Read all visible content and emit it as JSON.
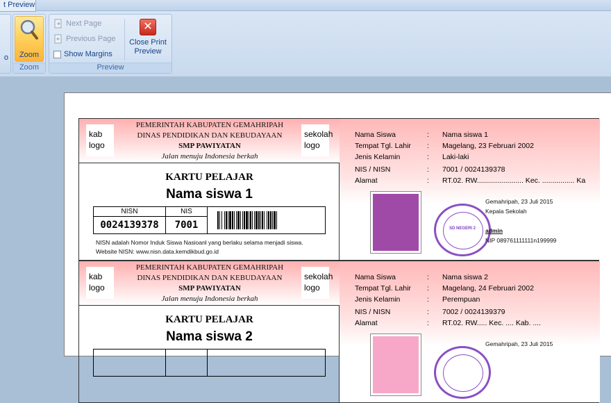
{
  "ribbon": {
    "tab_label": "t Preview",
    "zoom_group": {
      "label": "Zoom",
      "button_label": "Zoom"
    },
    "preview_group": {
      "label": "Preview",
      "next_page": "Next Page",
      "previous_page": "Previous Page",
      "show_margins": "Show Margins",
      "close_line1": "Close Print",
      "close_line2": "Preview"
    }
  },
  "cards": [
    {
      "header": {
        "line1": "PEMERINTAH KABUPATEN GEMAHRIPAH",
        "line2": "DINAS PENDIDIKAN DAN KEBUDAYAAN",
        "line3": "SMP PAWIYATAN",
        "line4": "Jalan menuju Indonesia berkah",
        "logo_left": "kab\nlogo",
        "logo_left_1": "kab",
        "logo_left_2": "logo",
        "logo_right_1": "sekolah",
        "logo_right_2": "logo"
      },
      "title": "KARTU PELAJAR",
      "name": "Nama siswa 1",
      "nisn_label": "NISN",
      "nis_label": "NIS",
      "nisn": "0024139378",
      "nis": "7001",
      "note1": "NISN adalah Nomor Induk Siswa Nasioanl yang berlaku selama menjadi siswa.",
      "note2": "Website NISN: www.nisn.data.kemdikbud.go.id",
      "info": [
        {
          "k": "Nama Siswa",
          "v": "Nama siswa 1"
        },
        {
          "k": "Tempat Tgl. Lahir",
          "v": "Magelang, 23 Februari 2002"
        },
        {
          "k": "Jenis Kelamin",
          "v": "Laki-laki"
        },
        {
          "k": "NIS / NISN",
          "v": "7001 / 0024139378"
        },
        {
          "k": "Alamat",
          "v": "RT.02. RW....................... Kec. ................ Ka"
        }
      ],
      "photo_color": "#a04aa8",
      "date": "Gemahripah, 23 Juli 2015",
      "role": "Kepala Sekolah",
      "signer": "admin",
      "nip": "NIP 089761111111n199999"
    },
    {
      "header": {
        "line1": "PEMERINTAH KABUPATEN GEMAHRIPAH",
        "line2": "DINAS PENDIDIKAN DAN KEBUDAYAAN",
        "line3": "SMP PAWIYATAN",
        "line4": "Jalan menuju Indonesia berkah",
        "logo_left_1": "kab",
        "logo_left_2": "logo",
        "logo_right_1": "sekolah",
        "logo_right_2": "logo"
      },
      "title": "KARTU PELAJAR",
      "name": "Nama siswa 2",
      "info": [
        {
          "k": "Nama Siswa",
          "v": "Nama siswa 2"
        },
        {
          "k": "Tempat Tgl. Lahir",
          "v": "Magelang, 24 Februari 2002"
        },
        {
          "k": "Jenis Kelamin",
          "v": "Perempuan"
        },
        {
          "k": "NIS / NISN",
          "v": "7002 / 0024139379"
        },
        {
          "k": "Alamat",
          "v": "RT.02. RW..... Kec. .... Kab. ...."
        }
      ],
      "photo_color": "#f7a8c8",
      "date": "Gemahripah, 23 Juli 2015"
    }
  ],
  "stamp_text": "SD NEGERI 2",
  "colors": {
    "accent": "#15428b",
    "stamp": "#8a4fc4"
  }
}
